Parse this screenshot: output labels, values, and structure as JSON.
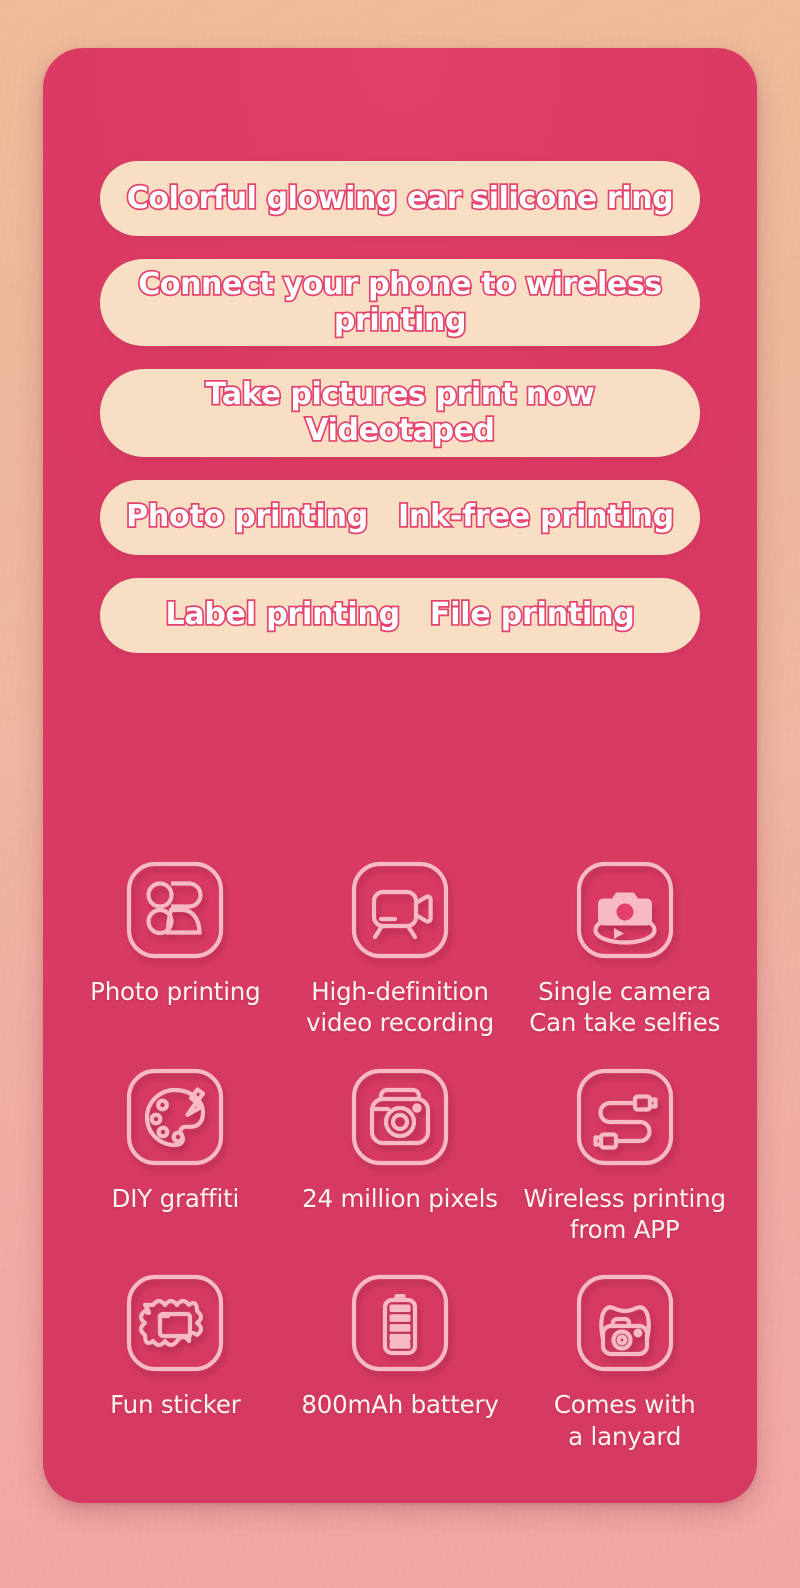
{
  "theme": {
    "background_top": "#eebb9a",
    "background_bottom": "#f1a7a3",
    "card_pink": "#da3a63",
    "pill_cream": "#f8dec2",
    "pill_text_fill": "#ffffff",
    "pill_text_stroke": "#e4436e",
    "icon_stroke": "#f7b9c4",
    "label_text": "#fdf3f2"
  },
  "feature_pills": [
    {
      "id": "pill-ear-ring",
      "text": "Colorful glowing ear silicone ring",
      "two_column": false
    },
    {
      "id": "pill-wireless",
      "text": "Connect your phone to wireless\nprinting",
      "two_column": false
    },
    {
      "id": "pill-take-pictures",
      "text": "Take pictures print now\nVideotaped",
      "two_column": false
    },
    {
      "id": "pill-photo-ink",
      "text": "Photo printing",
      "text_right": "Ink-free printing",
      "two_column": true
    },
    {
      "id": "pill-label-file",
      "text": "Label printing",
      "text_right": "File printing",
      "two_column": true
    }
  ],
  "feature_grid": [
    {
      "icon": "photo-printing-icon",
      "label": "Photo printing"
    },
    {
      "icon": "video-camera-icon",
      "label": "High-definition\nvideo recording"
    },
    {
      "icon": "rotating-camera-icon",
      "label": "Single camera\nCan take selfies"
    },
    {
      "icon": "paint-palette-icon",
      "label": "DIY graffiti"
    },
    {
      "icon": "camera-icon",
      "label": "24 million pixels"
    },
    {
      "icon": "cable-connector-icon",
      "label": "Wireless printing\nfrom APP"
    },
    {
      "icon": "sticker-frame-icon",
      "label": "Fun sticker"
    },
    {
      "icon": "battery-icon",
      "label": "800mAh battery"
    },
    {
      "icon": "camera-lanyard-icon",
      "label": "Comes with\na lanyard"
    }
  ]
}
